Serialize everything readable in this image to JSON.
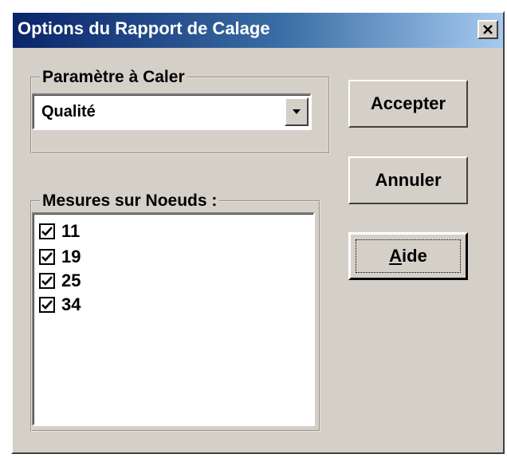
{
  "window": {
    "title": "Options du Rapport de Calage",
    "close_label": "X"
  },
  "parameter_group": {
    "label": "Paramètre à Caler",
    "selected_value": "Qualité"
  },
  "nodes_group": {
    "label": "Mesures sur Noeuds :",
    "items": [
      {
        "label": "11",
        "checked": true
      },
      {
        "label": "19",
        "checked": true
      },
      {
        "label": "25",
        "checked": true
      },
      {
        "label": "34",
        "checked": true
      }
    ]
  },
  "buttons": {
    "accept_label": "Accepter",
    "cancel_label": "Annuler",
    "help_mnemonic": "A",
    "help_rest": "ide"
  },
  "icons": {
    "close": "close-icon",
    "dropdown": "chevron-down-icon",
    "check": "check-icon"
  },
  "colors": {
    "title_start": "#0a246a",
    "title_end": "#a6caf0",
    "face": "#d4d0c8"
  }
}
